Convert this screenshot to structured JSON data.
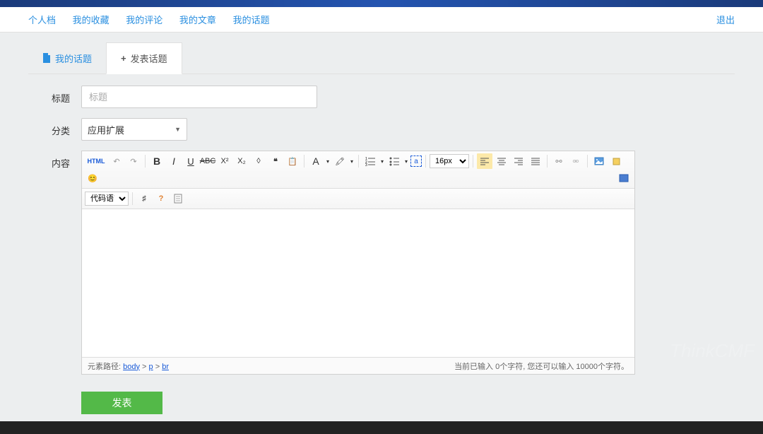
{
  "topnav": {
    "items": [
      "个人档",
      "我的收藏",
      "我的评论",
      "我的文章",
      "我的话题"
    ],
    "logout": "退出"
  },
  "tabs": {
    "my_topics": "我的话题",
    "post_topic": "发表话题"
  },
  "form": {
    "title_label": "标题",
    "title_placeholder": "标题",
    "category_label": "分类",
    "category_value": "应用扩展",
    "content_label": "内容"
  },
  "editor": {
    "html_btn": "HTML",
    "code_lang": "代码语言",
    "font_size_value": "16px",
    "status_path_label": "元素路径: ",
    "path_body": "body",
    "path_p": "p",
    "path_br": "br",
    "sep": " > ",
    "counter": "当前已输入 0个字符, 您还可以输入 10000个字符。"
  },
  "submit": "发表",
  "watermark": "ThinkCMF"
}
